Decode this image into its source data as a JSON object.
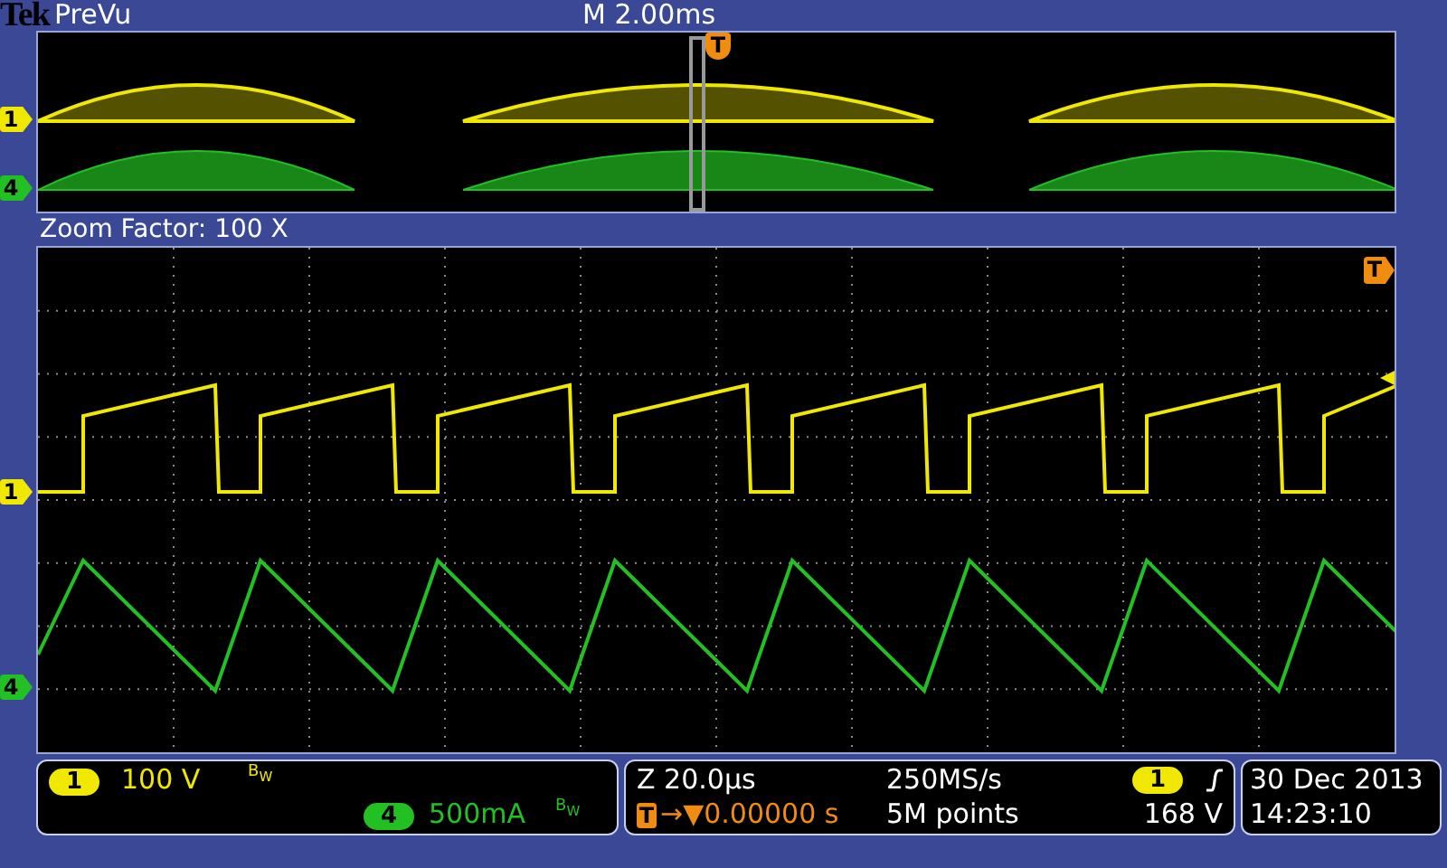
{
  "header": {
    "logo": "Tek",
    "mode": "PreVu",
    "timebase": "M 2.00ms"
  },
  "overview": {
    "markers": [
      "1",
      "4"
    ],
    "trigger": "T"
  },
  "zoom_factor": "Zoom Factor: 100 X",
  "main": {
    "markers": [
      "1",
      "4"
    ],
    "trigger": "T"
  },
  "channels": [
    {
      "badge": "1",
      "scale": "100 V",
      "bandwidth": "B$_{W}$",
      "color": "#f0e800"
    },
    {
      "badge": "4",
      "scale": "500mA",
      "bandwidth": "B$_{W}$",
      "color": "#22c022"
    }
  ],
  "timing": {
    "zoom_scale": "Z 20.0µs",
    "trigger_badge": "T",
    "delay": "→▼0.00000 s",
    "sample_rate": "250MS/s",
    "record_length": "5M points"
  },
  "trigger": {
    "source": "1",
    "level": "168 V"
  },
  "clock": {
    "date": "30 Dec 2013",
    "time": "14:23:10"
  }
}
